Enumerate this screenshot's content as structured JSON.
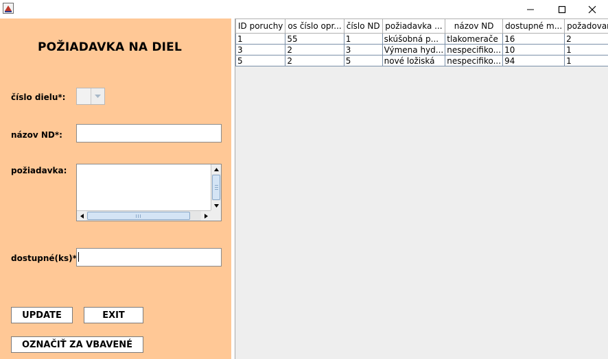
{
  "form": {
    "title": "POŽIADAVKA NA DIEL",
    "cislo_dielu_label": "číslo dielu*:",
    "nazov_nd_label": "názov ND*:",
    "poziadavka_label": "požiadavka:",
    "dostupne_label": "dostupné(ks)*:",
    "nazov_nd_value": "",
    "poziadavka_value": "",
    "dostupne_value": ""
  },
  "buttons": {
    "update": "UPDATE",
    "exit": "EXIT",
    "oznacit": "OZNAČIŤ ZA VBAVENÉ"
  },
  "table": {
    "columns": [
      "ID poruchy",
      "os číslo opr...",
      "číslo ND",
      "požiadavka ...",
      "názov ND",
      "dostupné m...",
      "požadované..."
    ],
    "rows": [
      [
        "1",
        "55",
        "1",
        "skúšobná p...",
        "tlakomerače",
        "16",
        "2"
      ],
      [
        "3",
        "2",
        "3",
        "Výmena hyd...",
        "nespecifiko...",
        "10",
        "1"
      ],
      [
        "5",
        "2",
        "5",
        "nové ložiská",
        "nespecifiko...",
        "94",
        "1"
      ]
    ]
  },
  "icons": {
    "app": "java-app-icon",
    "minimize": "minimize-icon",
    "maximize": "maximize-icon",
    "close": "close-icon"
  }
}
